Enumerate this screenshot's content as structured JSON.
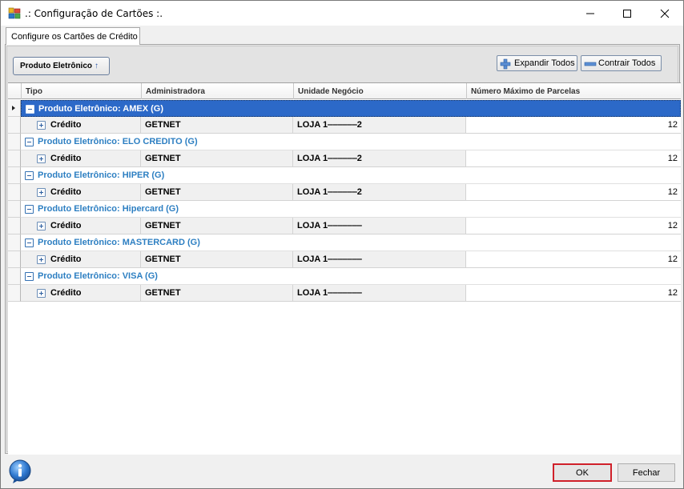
{
  "window": {
    "title": ".: Configuração de Cartões :."
  },
  "tabs": [
    {
      "label": "Configure os Cartões de Crédito",
      "active": true
    }
  ],
  "toolbar": {
    "group_by_label": "Produto Eletrônico",
    "group_sort_icon": "arrow-up-icon",
    "expand_all_label": "Expandir Todos",
    "collapse_all_label": "Contrair Todos"
  },
  "grid": {
    "columns": [
      "Tipo",
      "Administradora",
      "Unidade Negócio",
      "Número Máximo de Parcelas"
    ],
    "groups": [
      {
        "title": "Produto Eletrônico: AMEX (G)",
        "selected": true,
        "row": {
          "tipo": "Crédito",
          "administradora": "GETNET",
          "unidade": "LOJA 1‒‒‒‒‒‒2",
          "parcelas": "12"
        }
      },
      {
        "title": "Produto Eletrônico: ELO CREDITO (G)",
        "selected": false,
        "row": {
          "tipo": "Crédito",
          "administradora": "GETNET",
          "unidade": "LOJA 1‒‒‒‒‒‒2",
          "parcelas": "12"
        }
      },
      {
        "title": "Produto Eletrônico: HIPER (G)",
        "selected": false,
        "row": {
          "tipo": "Crédito",
          "administradora": "GETNET",
          "unidade": "LOJA 1‒‒‒‒‒‒2",
          "parcelas": "12"
        }
      },
      {
        "title": "Produto Eletrônico: Hipercard (G)",
        "selected": false,
        "row": {
          "tipo": "Crédito",
          "administradora": "GETNET",
          "unidade": "LOJA 1‒‒‒‒‒‒‒",
          "parcelas": "12"
        }
      },
      {
        "title": "Produto Eletrônico: MASTERCARD (G)",
        "selected": false,
        "row": {
          "tipo": "Crédito",
          "administradora": "GETNET",
          "unidade": "LOJA 1‒‒‒‒‒‒‒",
          "parcelas": "12"
        }
      },
      {
        "title": "Produto Eletrônico: VISA (G)",
        "selected": false,
        "row": {
          "tipo": "Crédito",
          "administradora": "GETNET",
          "unidade": "LOJA 1‒‒‒‒‒‒‒",
          "parcelas": "12"
        }
      }
    ]
  },
  "footer": {
    "ok_label": "OK",
    "cancel_label": "Fechar",
    "info_icon": "info-icon"
  },
  "colors": {
    "group_text": "#2d7fc2",
    "selected_row": "#2c69c8",
    "ok_border": "#d0202a"
  }
}
